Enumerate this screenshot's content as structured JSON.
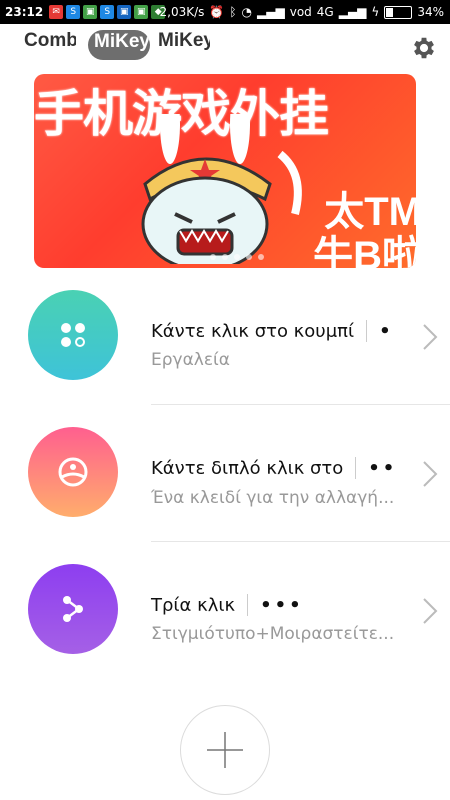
{
  "status_bar": {
    "time": "23:12",
    "speed": "2,03K/s",
    "carrier": "vod",
    "network": "4G",
    "battery": "34%",
    "battery_level": 0.34
  },
  "tabs": [
    {
      "label": "Combo",
      "active": false
    },
    {
      "label": "MiKey",
      "active": true
    },
    {
      "label": "MiKey",
      "active": false
    }
  ],
  "banner": {
    "headline": "手机游戏外挂",
    "side_line1": "太TM",
    "side_line2": "牛B啦"
  },
  "items": [
    {
      "title": "Κάντε κλικ στο κουμπί",
      "dots": "•",
      "subtitle": "Εργαλεία",
      "color_top": "#4ad1b3",
      "color_bottom": "#3ec3d8"
    },
    {
      "title": "Κάντε διπλό κλικ στο",
      "dots": "••",
      "subtitle": "Ένα κλειδί για την αλλαγή...",
      "color_top": "#ff5f8f",
      "color_bottom": "#ffad6c"
    },
    {
      "title": "Τρία κλικ",
      "dots": "•••",
      "subtitle": "Στιγμιότυπο+Μοιραστείτε...",
      "color_top": "#8d3ef0",
      "color_bottom": "#a560e6"
    }
  ],
  "icons": {
    "settings": "gear-icon",
    "add": "plus-icon"
  }
}
